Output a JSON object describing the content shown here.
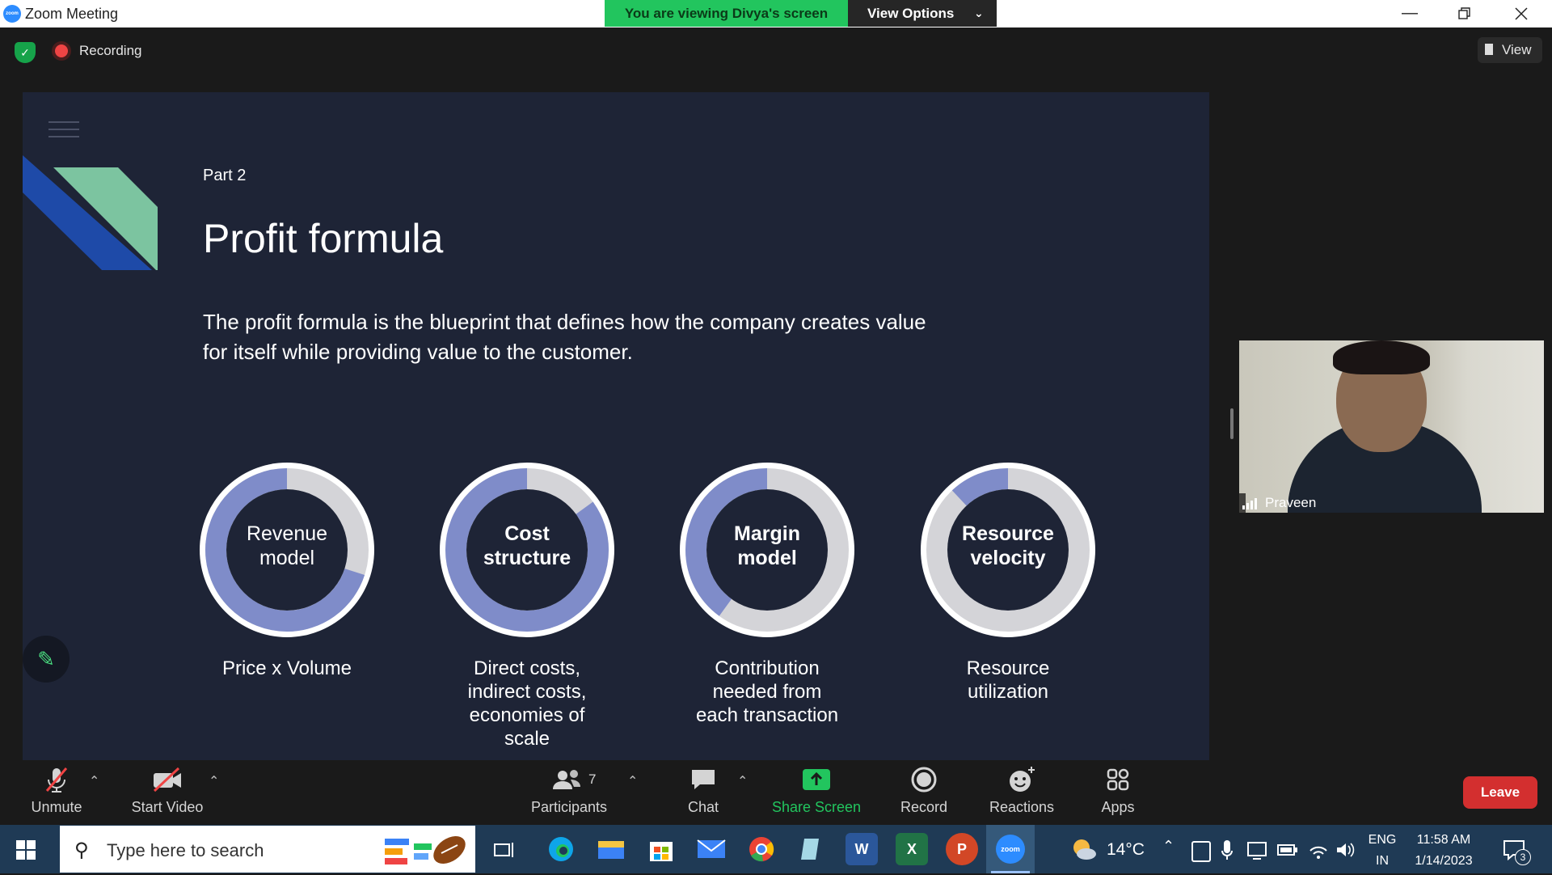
{
  "window": {
    "title": "Zoom Meeting",
    "app_icon_text": "zoom",
    "banner_text": "You are viewing Divya's screen",
    "view_options_label": "View Options",
    "controls": [
      "minimize",
      "restore",
      "close"
    ]
  },
  "meeting_bar": {
    "recording_label": "Recording",
    "view_label": "View"
  },
  "slide": {
    "part": "Part 2",
    "title": "Profit formula",
    "description": " The profit formula is the blueprint that defines how the company creates value for itself while providing value to the customer.",
    "rings": [
      {
        "label_line1": "Revenue",
        "label_line2": "model",
        "fill_fraction": 0.7,
        "caption": [
          "Price x Volume"
        ]
      },
      {
        "label_line1": "Cost",
        "label_line2": "structure",
        "fill_fraction": 0.85,
        "caption": [
          "Direct costs,",
          "indirect costs,",
          "economies of",
          "scale"
        ]
      },
      {
        "label_line1": "Margin",
        "label_line2": "model",
        "fill_fraction": 0.4,
        "caption": [
          "Contribution",
          "needed from",
          "each transaction"
        ]
      },
      {
        "label_line1": "Resource",
        "label_line2": "velocity",
        "fill_fraction": 0.12,
        "caption": [
          "Resource",
          "utilization"
        ]
      }
    ]
  },
  "participant_video": {
    "name": "Praveen"
  },
  "toolbar": {
    "unmute": "Unmute",
    "start_video": "Start Video",
    "participants": "Participants",
    "participant_count": "7",
    "chat": "Chat",
    "share_screen": "Share Screen",
    "record": "Record",
    "reactions": "Reactions",
    "apps": "Apps",
    "leave": "Leave"
  },
  "taskbar": {
    "search_placeholder": "Type here to search",
    "weather": "14°C",
    "language_line1": "ENG",
    "language_line2": "IN",
    "time": "11:58 AM",
    "date": "1/14/2023",
    "notification_count": "3"
  },
  "colors": {
    "slide_bg": "#1e2436",
    "ring_fill": "#7f8cc9",
    "ring_track": "#d4d4d8",
    "share_green": "#22c55e",
    "leave_red": "#d32f2f"
  }
}
